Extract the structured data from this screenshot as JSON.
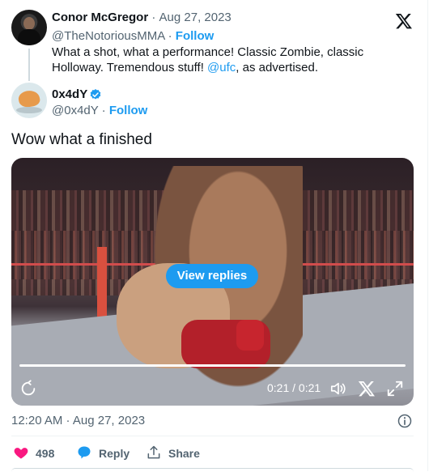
{
  "quoted_tweet": {
    "author_name": "Conor McGregor",
    "separator": "·",
    "date": "Aug 27, 2023",
    "handle": "@TheNotoriousMMA",
    "follow_label": "Follow",
    "text_part1": "What a shot, what a performance! Classic Zombie, classic Holloway. Tremendous stuff! ",
    "mention": "@ufc",
    "text_part2": ", as advertised."
  },
  "tweet": {
    "author_name": "0x4dY",
    "handle": "@0x4dY",
    "follow_label": "Follow",
    "text": "Wow what a finished",
    "timestamp": "12:20 AM · Aug 27, 2023"
  },
  "video": {
    "overlay_button": "View replies",
    "time": "0:21 / 0:21",
    "progress_fraction": 1.0
  },
  "actions": {
    "like_count": "498",
    "reply_label": "Reply",
    "share_label": "Share"
  },
  "colors": {
    "accent": "#1d9bf0",
    "like": "#f91880",
    "text_secondary": "#536471"
  },
  "icons": {
    "brand": "x-logo-icon",
    "verified": "verified-badge-icon",
    "info": "info-icon",
    "replay": "replay-icon",
    "volume": "volume-icon",
    "fullscreen": "fullscreen-icon",
    "like": "heart-icon",
    "reply": "reply-bubble-icon",
    "share": "share-icon"
  }
}
